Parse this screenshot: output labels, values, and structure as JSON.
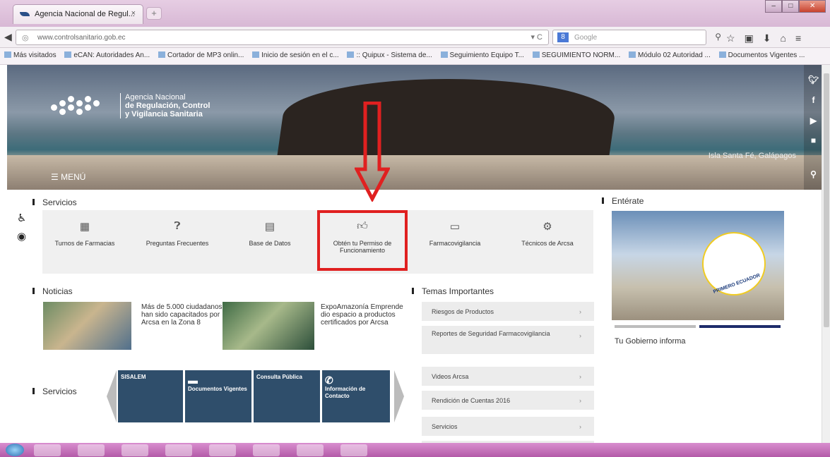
{
  "browser": {
    "tab_title": "Agencia Nacional de Regul...",
    "url": "www.controlsanitario.gob.ec",
    "search_placeholder": "Google",
    "bookmarks": [
      "Más visitados",
      "eCAN: Autoridades An...",
      "Cortador de MP3 onlin...",
      "Inicio de sesión en el c...",
      ":: Quipux - Sistema de...",
      "Seguimiento Equipo T...",
      "SEGUIMIENTO NORM...",
      "Módulo 02 Autoridad ...",
      "Documentos Vigentes ..."
    ]
  },
  "header": {
    "logo_line1": "Agencia Nacional",
    "logo_line2": "de Regulación, Control",
    "logo_line3": "y Vigilancia Sanitaria",
    "menu_label": "☰ MENÚ",
    "caption": "Isla Santa Fé, Galápagos"
  },
  "servicios": {
    "title": "Servicios",
    "items": [
      {
        "label": "Turnos de Farmacias",
        "icon": "calendar-icon"
      },
      {
        "label": "Preguntas Frecuentes",
        "icon": "question-icon"
      },
      {
        "label": "Base de Datos",
        "icon": "database-icon"
      },
      {
        "label": "Obtén tu Permiso de Funcionamiento",
        "icon": "thumbs-up-icon"
      },
      {
        "label": "Farmacovigilancia",
        "icon": "monitor-icon"
      },
      {
        "label": "Técnicos de Arcsa",
        "icon": "technician-icon"
      }
    ]
  },
  "enterate": {
    "title": "Entérate",
    "banner_text": "PRIMERO ECUADOR",
    "caption": "Tu Gobierno informa"
  },
  "noticias": {
    "title": "Noticias",
    "items": [
      {
        "text": "Más de 5.000 ciudadanos han sido capacitados por Arcsa en la Zona 8"
      },
      {
        "text": "ExpoAmazonía Emprende dio espacio a productos certificados por Arcsa"
      }
    ]
  },
  "temas": {
    "title": "Temas Importantes",
    "items": [
      "Riesgos de Productos",
      "Reportes de Seguridad Farmacovigilancia",
      "Videos Arcsa",
      "Rendición de Cuentas 2016",
      "Servicios"
    ]
  },
  "servicios2": {
    "title": "Servicios",
    "tiles": [
      "SISALEM",
      "Documentos Vigentes",
      "Consulta Pública",
      "Información de Contacto"
    ]
  },
  "colors": {
    "accent": "#e02020",
    "tile": "#2f4e6b"
  }
}
